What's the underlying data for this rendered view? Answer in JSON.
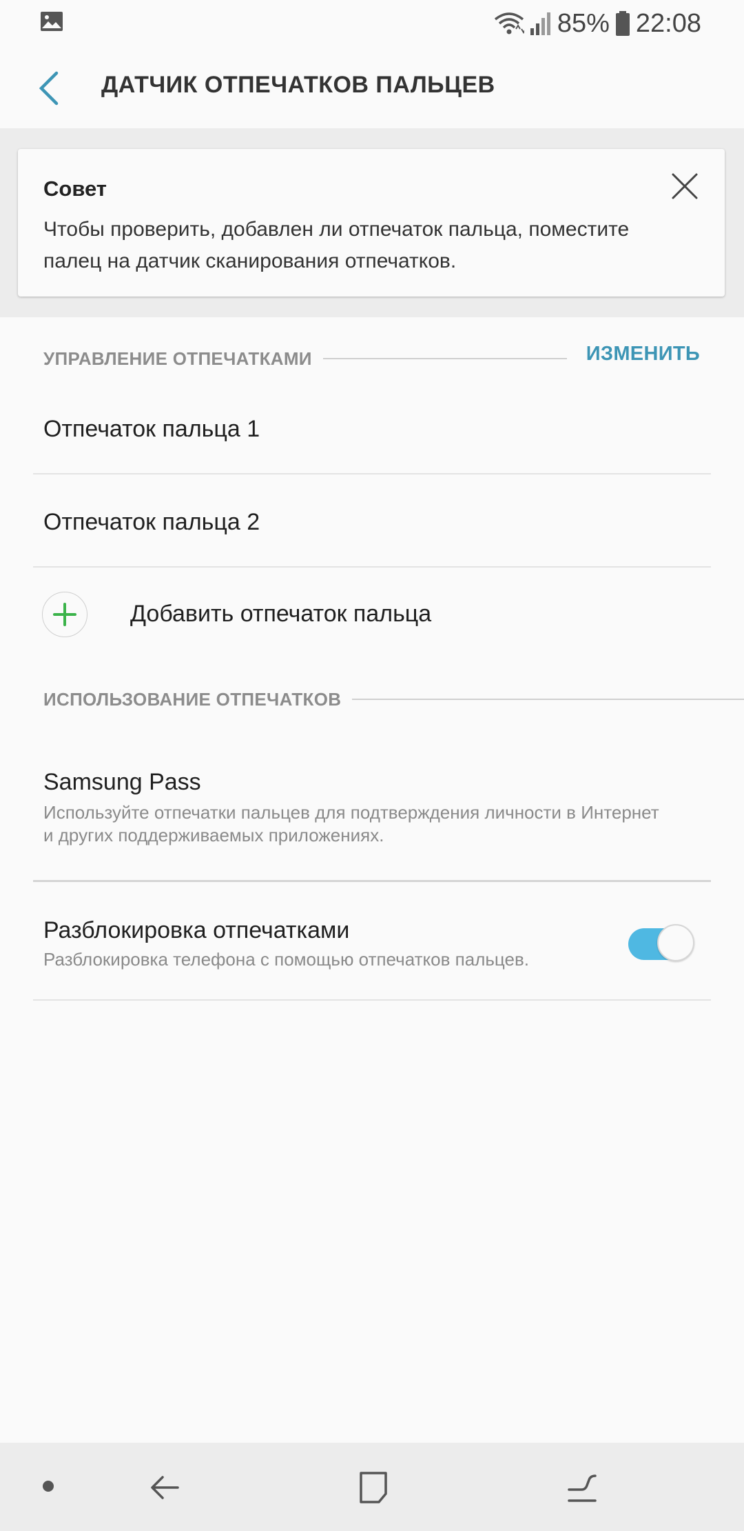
{
  "status_bar": {
    "battery": "85%",
    "time": "22:08",
    "icons": [
      "gallery-icon",
      "wifi-icon",
      "signal-icon",
      "battery-icon"
    ]
  },
  "app_bar": {
    "title": "ДАТЧИК ОТПЕЧАТКОВ ПАЛЬЦЕВ"
  },
  "tip": {
    "title": "Совет",
    "text": "Чтобы проверить, добавлен ли отпечаток пальца, поместите палец на датчик сканирования отпечатков."
  },
  "fingerprint_management": {
    "header": "УПРАВЛЕНИЕ ОТПЕЧАТКАМИ",
    "edit_label": "ИЗМЕНИТЬ",
    "items": [
      {
        "label": "Отпечаток пальца 1"
      },
      {
        "label": "Отпечаток пальца 2"
      }
    ],
    "add_label": "Добавить отпечаток пальца"
  },
  "fingerprint_usage": {
    "header": "ИСПОЛЬЗОВАНИЕ ОТПЕЧАТКОВ",
    "samsung_pass": {
      "title": "Samsung Pass",
      "description": "Используйте отпечатки пальцев для подтверждения личности в Интернет и других поддерживаемых приложениях."
    },
    "unlock": {
      "title": "Разблокировка отпечатками",
      "description": "Разблокировка телефона с помощью отпечатков пальцев.",
      "enabled": true
    }
  },
  "colors": {
    "accent": "#3d95b5",
    "toggle_on": "#4fb8e2",
    "add_plus": "#3bb34a"
  }
}
